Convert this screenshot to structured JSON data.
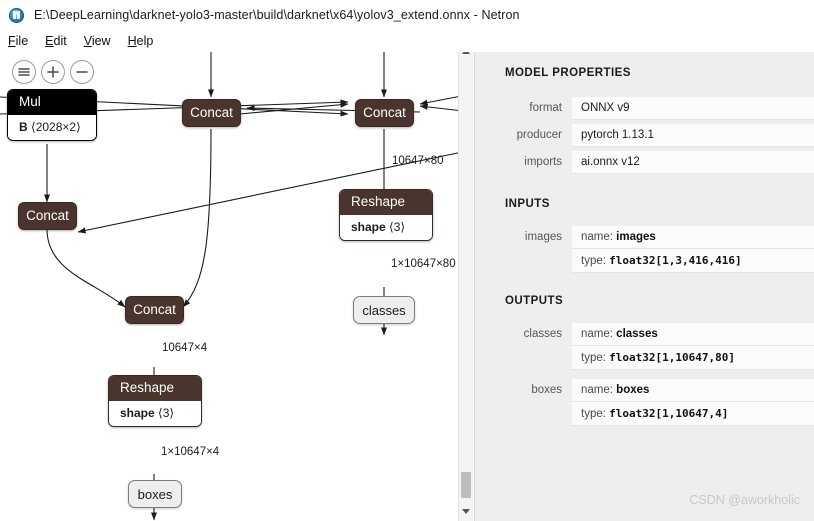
{
  "window": {
    "title": "E:\\DeepLearning\\darknet-yolo3-master\\build\\darknet\\x64\\yolov3_extend.onnx - Netron",
    "app_icon": "netron-icon"
  },
  "menubar": {
    "items": [
      {
        "label": "File",
        "accel": "F"
      },
      {
        "label": "Edit",
        "accel": "E"
      },
      {
        "label": "View",
        "accel": "V"
      },
      {
        "label": "Help",
        "accel": "H"
      }
    ]
  },
  "graph_toolbar": {
    "buttons": [
      {
        "icon": "hamburger-menu-icon",
        "title": "Menu"
      },
      {
        "icon": "zoom-in-icon",
        "title": "Zoom In"
      },
      {
        "icon": "zoom-out-icon",
        "title": "Zoom Out"
      }
    ]
  },
  "graph": {
    "nodes": [
      {
        "id": "mul",
        "kind": "card",
        "title": "Mul",
        "attr_name": "B",
        "attr_value": "⟨2028×2⟩",
        "selected": true
      },
      {
        "id": "concat_a",
        "kind": "op",
        "title": "Concat"
      },
      {
        "id": "concat_b",
        "kind": "op",
        "title": "Concat"
      },
      {
        "id": "concat_c",
        "kind": "op",
        "title": "Concat"
      },
      {
        "id": "concat_d",
        "kind": "op",
        "title": "Concat"
      },
      {
        "id": "reshape_1",
        "kind": "card",
        "title": "Reshape",
        "attr_name": "shape",
        "attr_value": "⟨3⟩",
        "selected": false
      },
      {
        "id": "reshape_2",
        "kind": "card",
        "title": "Reshape",
        "attr_name": "shape",
        "attr_value": "⟨3⟩",
        "selected": false
      },
      {
        "id": "classes",
        "kind": "io",
        "title": "classes"
      },
      {
        "id": "boxes",
        "kind": "io",
        "title": "boxes"
      }
    ],
    "edge_labels": [
      {
        "id": "e1",
        "text": "10647×80"
      },
      {
        "id": "e2",
        "text": "1×10647×80"
      },
      {
        "id": "e3",
        "text": "10647×4"
      },
      {
        "id": "e4",
        "text": "1×10647×4"
      }
    ]
  },
  "sidebar": {
    "model_properties": {
      "heading": "MODEL PROPERTIES",
      "rows": [
        {
          "name": "format",
          "value": "ONNX v9"
        },
        {
          "name": "producer",
          "value": "pytorch 1.13.1"
        },
        {
          "name": "imports",
          "value": "ai.onnx v12"
        }
      ]
    },
    "inputs": {
      "heading": "INPUTS",
      "items": [
        {
          "name": "images",
          "name_key": "name:",
          "name_val": "images",
          "type_key": "type:",
          "type_val": "float32[1,3,416,416]"
        }
      ]
    },
    "outputs": {
      "heading": "OUTPUTS",
      "items": [
        {
          "name": "classes",
          "name_key": "name:",
          "name_val": "classes",
          "type_key": "type:",
          "type_val": "float32[1,10647,80]"
        },
        {
          "name": "boxes",
          "name_key": "name:",
          "name_val": "boxes",
          "type_key": "type:",
          "type_val": "float32[1,10647,4]"
        }
      ]
    }
  },
  "watermark": {
    "text": "CSDN @aworkholic"
  },
  "colors": {
    "node_fill": "#4a342e",
    "node_selected": "#000000",
    "io_fill": "#eeeeee",
    "sidebar_bg": "#eeeeee",
    "value_bg": "#fbfbfb"
  }
}
